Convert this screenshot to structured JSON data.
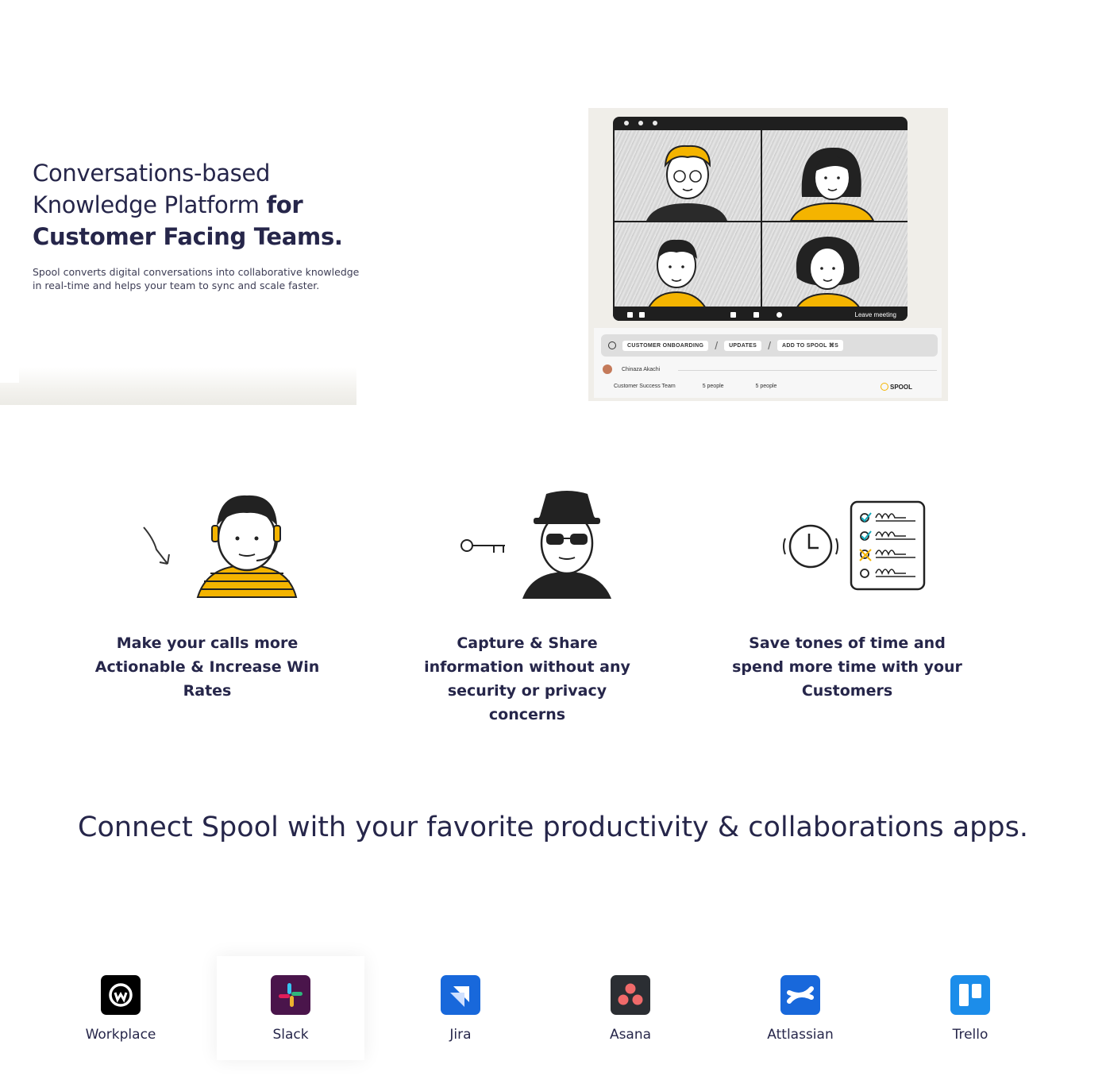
{
  "hero": {
    "title_line1": "Conversations-based",
    "title_line2_regular": "Knowledge Platform",
    "title_line2_bold": "for",
    "title_line3": "Customer Facing Teams.",
    "subtitle": "Spool converts digital conversations into collaborative knowledge in real-time and helps your team to sync and scale faster."
  },
  "mockup": {
    "leave_label": "Leave meeting",
    "chips": [
      "CUSTOMER ONBOARDING",
      "UPDATES",
      "ADD TO SPOOL ⌘S"
    ],
    "user_name": "Chinaza Akachi",
    "team_name": "Customer Success Team",
    "people_1": "5 people",
    "people_2": "5 people",
    "logo_text": "SPOOL"
  },
  "features": [
    {
      "text": "Make your calls more Actionable & Increase Win Rates"
    },
    {
      "text": "Capture & Share information without any security or privacy concerns"
    },
    {
      "text": "Save tones of time and spend more time with your Customers"
    }
  ],
  "integrations": {
    "title": "Connect Spool with your favorite productivity & collaborations apps.",
    "apps": [
      {
        "label": "Workplace",
        "icon": "workplace-icon",
        "color": "#000000"
      },
      {
        "label": "Slack",
        "icon": "slack-icon",
        "color": "#4a154b"
      },
      {
        "label": "Jira",
        "icon": "jira-icon",
        "color": "#1868db"
      },
      {
        "label": "Asana",
        "icon": "asana-icon",
        "color": "#2b2e33"
      },
      {
        "label": "Attlassian",
        "icon": "confluence-icon",
        "color": "#1868db"
      },
      {
        "label": "Trello",
        "icon": "trello-icon",
        "color": "#1c8dea"
      }
    ]
  },
  "colors": {
    "accent_yellow": "#f4b400",
    "text_dark": "#26264a"
  }
}
